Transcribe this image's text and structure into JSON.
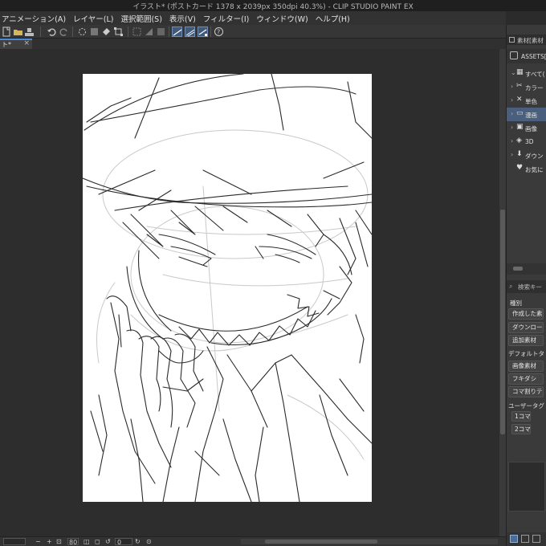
{
  "window": {
    "title": "イラスト* (ポストカード 1378 x 2039px 350dpi 40.3%)  - CLIP STUDIO PAINT EX"
  },
  "menu": [
    "アニメーション(A)",
    "レイヤー(L)",
    "選択範囲(S)",
    "表示(V)",
    "フィルター(I)",
    "ウィンドウ(W)",
    "ヘルプ(H)"
  ],
  "document_tab": {
    "label": "ト*",
    "close": "×"
  },
  "status": {
    "zoom": "80",
    "angle": "0"
  },
  "right_panel": {
    "header": "素材[素材",
    "sub_header": "ASSETS[ご",
    "tree": [
      {
        "label": "すべて(",
        "icon": "grid-icon",
        "glyph": "▦"
      },
      {
        "label": "カラー",
        "icon": "palette-icon",
        "glyph": "✂"
      },
      {
        "label": "単色",
        "icon": "monochrome-icon",
        "glyph": "✕"
      },
      {
        "label": "漫画",
        "icon": "manga-icon",
        "glyph": "▭"
      },
      {
        "label": "画像",
        "icon": "image-icon",
        "glyph": "▣"
      },
      {
        "label": "3D",
        "icon": "3d-icon",
        "glyph": "◈"
      },
      {
        "label": "ダウン",
        "icon": "download-icon",
        "glyph": "⬇"
      },
      {
        "label": "お気に",
        "icon": "heart-icon",
        "glyph": "♥"
      }
    ],
    "selected_index": 3,
    "search_placeholder": "検索キー",
    "kind_label": "種別",
    "kind_buttons": [
      "作成した素",
      "ダウンロード",
      "追加素材"
    ],
    "default_tags_label": "デフォルトタ",
    "default_tags": [
      "画像素材",
      "フキダシ",
      "コマ割りテン"
    ],
    "user_tags_label": "ユーザータグ",
    "user_tags": [
      "1コマ",
      "2コマ"
    ]
  },
  "colors": {
    "accent": "#4d8ad6",
    "selected_row": "#4a5f7d",
    "canvas_bg": "#2d2d2d",
    "paper": "#ffffff"
  }
}
